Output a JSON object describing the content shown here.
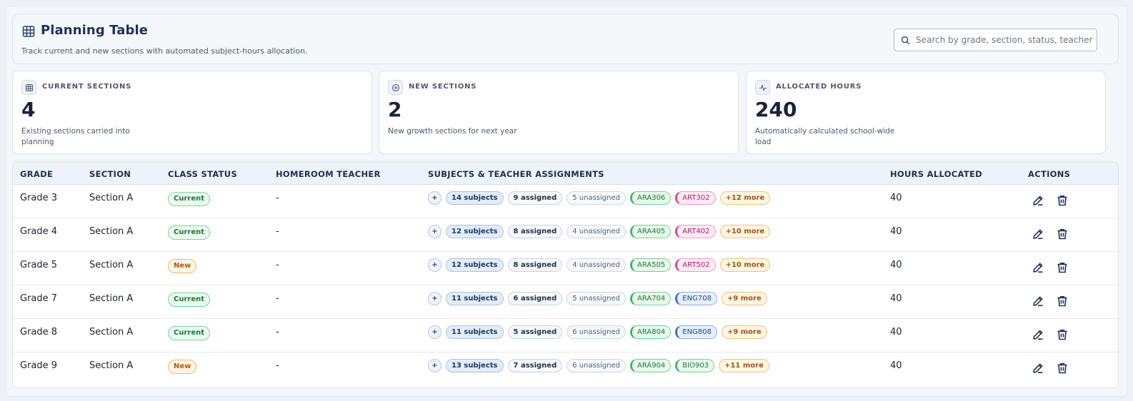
{
  "header": {
    "title": "Planning Table",
    "subtitle": "Track current and new sections with automated subject-hours allocation.",
    "search_placeholder": "Search by grade, section, status, teacher, subject"
  },
  "cards": [
    {
      "label": "CURRENT SECTIONS",
      "value": "4",
      "desc": "Existing sections carried into planning",
      "icon": "table-icon"
    },
    {
      "label": "NEW SECTIONS",
      "value": "2",
      "desc": "New growth sections for next year",
      "icon": "plus-circle-icon"
    },
    {
      "label": "ALLOCATED HOURS",
      "value": "240",
      "desc": "Automatically calculated school-wide load",
      "icon": "activity-icon"
    }
  ],
  "table": {
    "headers": {
      "grade": "GRADE",
      "section": "SECTION",
      "status": "CLASS STATUS",
      "teacher": "HOMEROOM TEACHER",
      "subjects": "SUBJECTS & TEACHER ASSIGNMENTS",
      "hours": "HOURS ALLOCATED",
      "actions": "ACTIONS"
    },
    "rows": [
      {
        "grade": "Grade 3",
        "section": "Section A",
        "status": "Current",
        "teacher": "-",
        "plus": "+",
        "subjects": "14 subjects",
        "assigned": "9 assigned",
        "unassigned": "5 unassigned",
        "code1": "ARA306",
        "code2": "ART302",
        "more": "+12 more",
        "hours": "40"
      },
      {
        "grade": "Grade 4",
        "section": "Section A",
        "status": "Current",
        "teacher": "-",
        "plus": "+",
        "subjects": "12 subjects",
        "assigned": "8 assigned",
        "unassigned": "4 unassigned",
        "code1": "ARA405",
        "code2": "ART402",
        "more": "+10 more",
        "hours": "40"
      },
      {
        "grade": "Grade 5",
        "section": "Section A",
        "status": "New",
        "teacher": "-",
        "plus": "+",
        "subjects": "12 subjects",
        "assigned": "8 assigned",
        "unassigned": "4 unassigned",
        "code1": "ARA505",
        "code2": "ART502",
        "more": "+10 more",
        "hours": "40"
      },
      {
        "grade": "Grade 7",
        "section": "Section A",
        "status": "Current",
        "teacher": "-",
        "plus": "+",
        "subjects": "11 subjects",
        "assigned": "6 assigned",
        "unassigned": "5 unassigned",
        "code1": "ARA704",
        "code2": "ENG708",
        "more": "+9 more",
        "hours": "40"
      },
      {
        "grade": "Grade 8",
        "section": "Section A",
        "status": "Current",
        "teacher": "-",
        "plus": "+",
        "subjects": "11 subjects",
        "assigned": "5 assigned",
        "unassigned": "6 unassigned",
        "code1": "ARA804",
        "code2": "ENG808",
        "more": "+9 more",
        "hours": "40"
      },
      {
        "grade": "Grade 9",
        "section": "Section A",
        "status": "New",
        "teacher": "-",
        "plus": "+",
        "subjects": "13 subjects",
        "assigned": "7 assigned",
        "unassigned": "6 unassigned",
        "code1": "ARA904",
        "code2": "BIO903",
        "more": "+11 more",
        "hours": "40"
      }
    ]
  },
  "colors": {
    "accent": "#1e3258",
    "status_current": "#1b7a3d",
    "status_new": "#b4590f",
    "chip_ara": "#3fb46a",
    "chip_art": "#d9468f",
    "chip_eng": "#3e6fc2",
    "chip_bio": "#3fb46a"
  },
  "icons": {
    "title": "table-icon",
    "search": "search-icon",
    "edit": "pencil-icon",
    "delete": "trash-icon"
  }
}
